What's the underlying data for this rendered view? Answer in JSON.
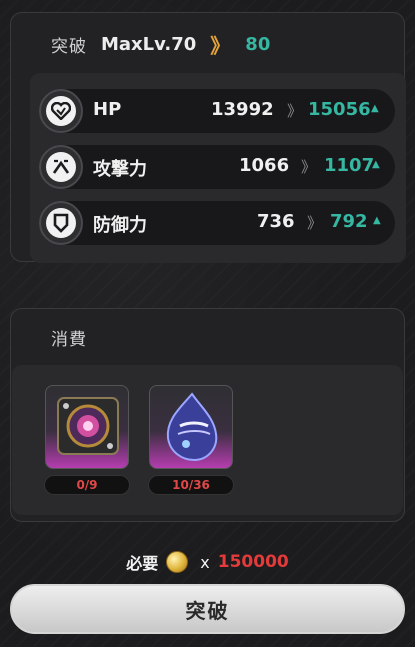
{
  "breakthrough": {
    "header_label": "突破",
    "maxlv_label": "MaxLv.70",
    "arrow_glyph": "》",
    "new_maxlv": "80"
  },
  "stats": [
    {
      "icon": "heart-icon",
      "label": "HP",
      "current": "13992",
      "arrow": "》",
      "next": "15056",
      "up": "▲"
    },
    {
      "icon": "attack-icon",
      "label": "攻撃力",
      "current": "1066",
      "arrow": "》",
      "next": "1107",
      "up": "▲"
    },
    {
      "icon": "shield-icon",
      "label": "防御力",
      "current": "736",
      "arrow": "》",
      "next": "792",
      "up": "▲"
    }
  ],
  "cost": {
    "label": "消費",
    "items": [
      {
        "icon": "ring-core-icon",
        "count": "0/9"
      },
      {
        "icon": "crystal-gem-icon",
        "count": "10/36"
      }
    ]
  },
  "required": {
    "label": "必要",
    "icon": "gold-coin-icon",
    "x": "x",
    "amount": "150000"
  },
  "button": {
    "label": "突破"
  },
  "colors": {
    "accent": "#35b7a2",
    "gold": "#e5a33b",
    "red": "#e53a3a",
    "item_glow": "#b63db0"
  }
}
